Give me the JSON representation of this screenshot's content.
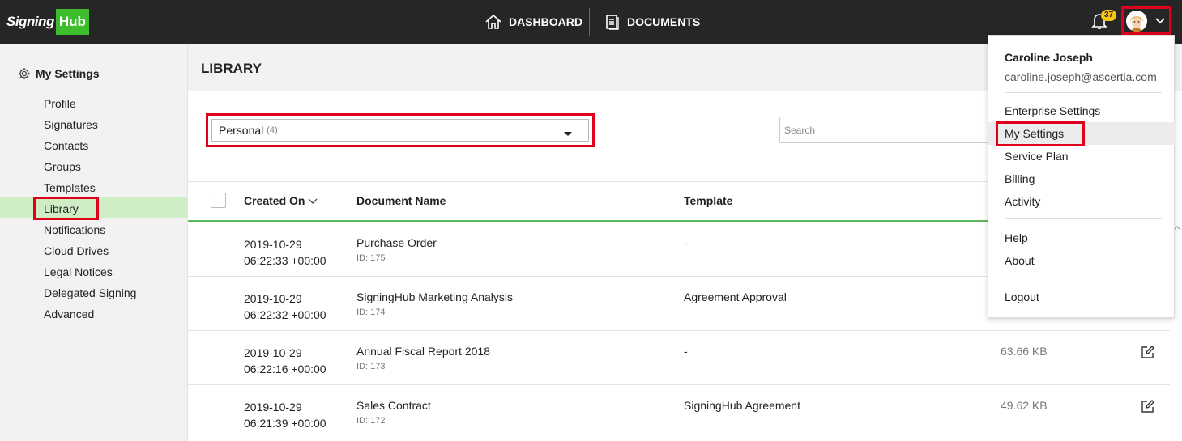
{
  "brand": {
    "signing": "Signing",
    "hub": "Hub",
    "accent": "#3ebd2f"
  },
  "nav": {
    "dashboard": "DASHBOARD",
    "documents": "DOCUMENTS"
  },
  "notifications": {
    "count": "37"
  },
  "sidebar": {
    "title": "My Settings",
    "items": [
      "Profile",
      "Signatures",
      "Contacts",
      "Groups",
      "Templates",
      "Library",
      "Notifications",
      "Cloud Drives",
      "Legal Notices",
      "Delegated Signing",
      "Advanced"
    ],
    "active": "Library"
  },
  "page": {
    "title": "LIBRARY"
  },
  "filter": {
    "value": "Personal",
    "count": "(4)"
  },
  "search": {
    "placeholder": "Search"
  },
  "table": {
    "headers": {
      "created_on": "Created On",
      "document_name": "Document Name",
      "template": "Template"
    },
    "rows": [
      {
        "date": "2019-10-29",
        "time": "06:22:33 +00:00",
        "name": "Purchase Order",
        "id": "ID: 175",
        "template": "-",
        "size": ""
      },
      {
        "date": "2019-10-29",
        "time": "06:22:32 +00:00",
        "name": "SigningHub Marketing Analysis",
        "id": "ID: 174",
        "template": "Agreement Approval",
        "size": ""
      },
      {
        "date": "2019-10-29",
        "time": "06:22:16 +00:00",
        "name": "Annual Fiscal Report 2018",
        "id": "ID: 173",
        "template": "-",
        "size": "63.66 KB"
      },
      {
        "date": "2019-10-29",
        "time": "06:21:39 +00:00",
        "name": "Sales Contract",
        "id": "ID: 172",
        "template": "SigningHub Agreement",
        "size": "49.62 KB"
      }
    ]
  },
  "user_menu": {
    "name": "Caroline Joseph",
    "email": "caroline.joseph@ascertia.com",
    "items": [
      "Enterprise Settings",
      "My Settings",
      "Service Plan",
      "Billing",
      "Activity"
    ],
    "help_items": [
      "Help",
      "About"
    ],
    "logout": "Logout"
  }
}
